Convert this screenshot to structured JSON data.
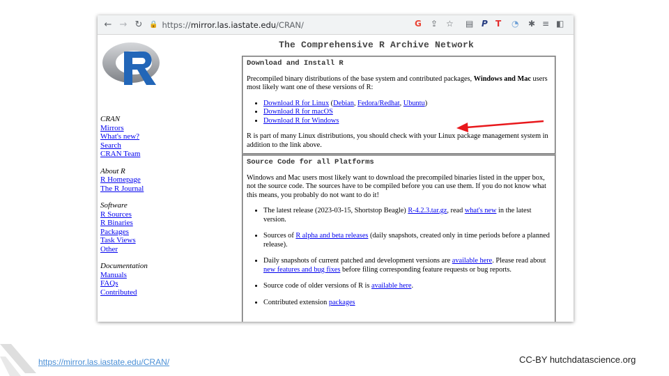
{
  "browser": {
    "url_host": "mirror.las.iastate.edu",
    "url_scheme": "https://",
    "url_path": "/CRAN/"
  },
  "page": {
    "title": "The Comprehensive R Archive Network",
    "sidebar": {
      "sections": [
        {
          "heading": "CRAN",
          "links": [
            "Mirrors",
            "What's new?",
            "Search",
            "CRAN Team"
          ]
        },
        {
          "heading": "About R",
          "links": [
            "R Homepage",
            "The R Journal"
          ]
        },
        {
          "heading": "Software",
          "links": [
            "R Sources",
            "R Binaries",
            "Packages",
            "Task Views",
            "Other"
          ]
        },
        {
          "heading": "Documentation",
          "links": [
            "Manuals",
            "FAQs",
            "Contributed"
          ]
        }
      ]
    },
    "download": {
      "heading": "Download and Install R",
      "intro_a": "Precompiled binary distributions of the base system and contributed packages, ",
      "intro_bold": "Windows and Mac",
      "intro_b": " users most likely want one of these versions of R:",
      "linux_link": "Download R for Linux",
      "linux_open": " (",
      "debian": "Debian",
      "fedora": "Fedora/Redhat",
      "ubuntu": "Ubuntu",
      "linux_close": ")",
      "comma1": ", ",
      "comma2": ", ",
      "macos_link": "Download R for macOS",
      "windows_link": "Download R for Windows",
      "outro": "R is part of many Linux distributions, you should check with your Linux package management system in addition to the link above."
    },
    "source": {
      "heading": "Source Code for all Platforms",
      "intro": "Windows and Mac users most likely want to download the precompiled binaries listed in the upper box, not the source code. The sources have to be compiled before you can use them. If you do not know what this means, you probably do not want to do it!",
      "item1_a": "The latest release (2023-03-15, Shortstop Beagle) ",
      "item1_link1": "R-4.2.3.tar.gz",
      "item1_b": ", read ",
      "item1_link2": "what's new",
      "item1_c": " in the latest version.",
      "item2_a": "Sources of ",
      "item2_link": "R alpha and beta releases",
      "item2_b": " (daily snapshots, created only in time periods before a planned release).",
      "item3_a": "Daily snapshots of current patched and development versions are ",
      "item3_link1": "available here",
      "item3_b": ". Please read about ",
      "item3_link2": "new features and bug fixes",
      "item3_c": " before filing corresponding feature requests or bug reports.",
      "item4_a": "Source code of older versions of R is ",
      "item4_link": "available here",
      "item4_b": ".",
      "item5_a": "Contributed extension ",
      "item5_link": "packages"
    }
  },
  "footer": {
    "url": "https://mirror.las.iastate.edu/CRAN/",
    "credit": "CC-BY hutchdatascience.org"
  },
  "colors": {
    "arrow": "#e8181c",
    "link": "#0000ee",
    "logo_blue": "#2266b8"
  },
  "icons": [
    "back-arrow-icon",
    "forward-arrow-icon",
    "reload-icon",
    "lock-icon",
    "google-icon",
    "share-icon",
    "star-icon",
    "reading-list-icon",
    "extension-puzzle-icon",
    "sidebar-icon"
  ]
}
